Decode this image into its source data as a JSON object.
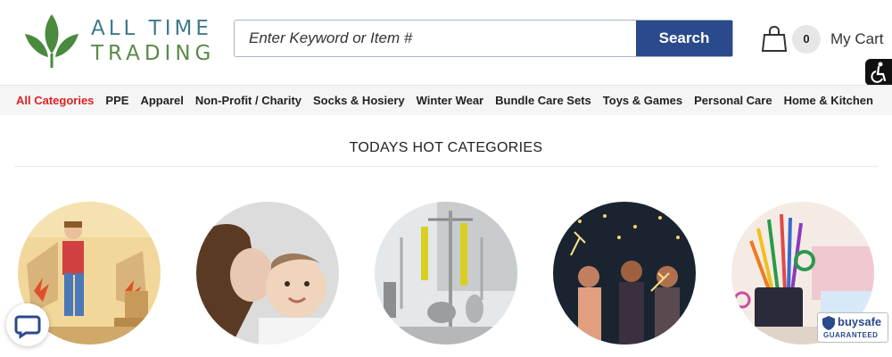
{
  "brand": {
    "line1": "ALL TIME",
    "line2": "TRADING"
  },
  "search": {
    "placeholder": "Enter Keyword or Item #",
    "button": "Search"
  },
  "cart": {
    "count": "0",
    "label": "My Cart"
  },
  "nav": {
    "items": [
      "All Categories",
      "PPE",
      "Apparel",
      "Non-Profit / Charity",
      "Socks & Hosiery",
      "Winter Wear",
      "Bundle Care Sets",
      "Toys & Games",
      "Personal Care",
      "Home & Kitchen"
    ]
  },
  "section": {
    "title": "TODAYS HOT CATEGORIES"
  },
  "badge": {
    "brand": "buysafe",
    "tag": "GUARANTEED"
  },
  "colors": {
    "accent": "#2a4a8c",
    "active": "#dd2222",
    "leaf": "#4a8a3f"
  }
}
